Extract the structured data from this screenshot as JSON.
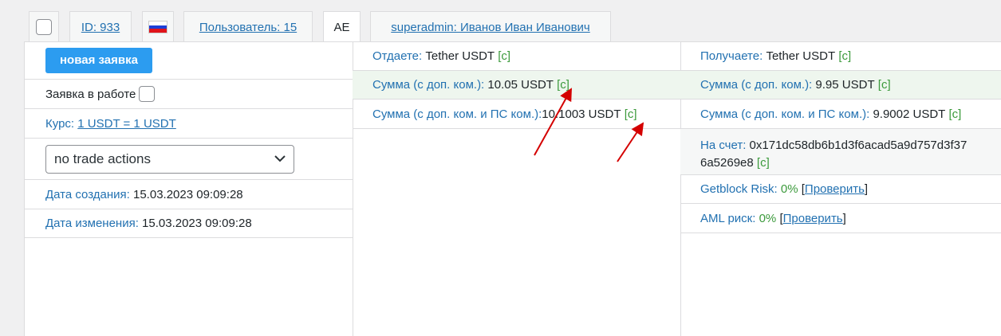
{
  "tabs": {
    "id_link": "ID: 933",
    "user_link": "Пользователь: 15",
    "country_code": "AE",
    "admin_link": "superadmin: Иванов Иван Иванович"
  },
  "left": {
    "new_request_button": "новая заявка",
    "in_work_label": "Заявка в работе",
    "rate_label": "Курс:",
    "rate_value": "1 USDT = 1 USDT",
    "trade_select_value": "no trade actions",
    "created_label": "Дата создания:",
    "created_value": "15.03.2023 09:09:28",
    "modified_label": "Дата изменения:",
    "modified_value": "15.03.2023 09:09:28"
  },
  "give": {
    "label": "Отдаете:",
    "value": "Tether USDT",
    "c1": "[c]",
    "sum_label": "Сумма (с доп. ком.):",
    "sum_value": "10.05 USDT",
    "c2": "[c]",
    "sum_ps_label": "Сумма (с доп. ком. и ПС ком.):",
    "sum_ps_value": "10.1003 USDT",
    "c3": "[c]"
  },
  "receive": {
    "label": "Получаете:",
    "value": "Tether USDT",
    "c1": "[c]",
    "sum_label": "Сумма (с доп. ком.):",
    "sum_value": "9.95 USDT",
    "c2": "[c]",
    "sum_ps_label": "Сумма (с доп. ком. и ПС ком.):",
    "sum_ps_value": "9.9002 USDT",
    "c3": "[c]",
    "account_label": "На счет:",
    "account_line1": "0x171dc58db6b1d3f6acad5a9d757d3f37",
    "account_line2": "6a5269e8",
    "c4": "[c]",
    "getblock_label": "Getblock Risk:",
    "getblock_value": "0%",
    "aml_label": "AML риск:",
    "aml_value": "0%",
    "check_link": "Проверить",
    "bracket_open": "[",
    "bracket_close": "]"
  },
  "colors": {
    "link": "#2271b1",
    "green": "#3c9a3c",
    "button": "#2c9cf0",
    "arrow": "#d40000"
  }
}
